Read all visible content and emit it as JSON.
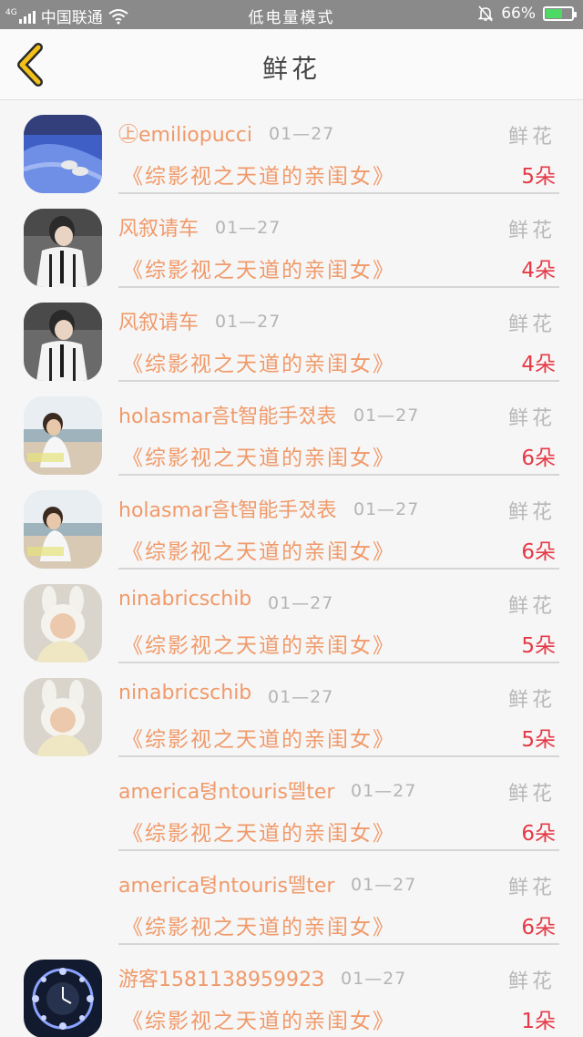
{
  "status_bar": {
    "network_label": "4G",
    "carrier": "中国联通",
    "mode": "低电量模式",
    "battery": "66%",
    "battery_level": 0.66,
    "icons": [
      "signal-icon",
      "wifi-icon",
      "mute-icon",
      "battery-icon"
    ]
  },
  "nav": {
    "title": "鲜花",
    "back_icon": "chevron-left-icon",
    "accent": "#f2c018"
  },
  "colors": {
    "name": "#f09a6a",
    "count": "#e53a47",
    "muted": "#b4b4b4"
  },
  "rows": [
    {
      "name": "㊤emiliopucci",
      "date": "01—27",
      "type": "鲜花",
      "book": "《综影视之天道的亲闺女》",
      "count": "5朵",
      "avatar": "blue-water-photo"
    },
    {
      "name": "风叙请车",
      "date": "01—27",
      "type": "鲜花",
      "book": "《综影视之天道的亲闺女》",
      "count": "4朵",
      "avatar": "boy-in-uniform-photo"
    },
    {
      "name": "风叙请车",
      "date": "01—27",
      "type": "鲜花",
      "book": "《综影视之天道的亲闺女》",
      "count": "4朵",
      "avatar": "boy-in-uniform-photo"
    },
    {
      "name": "holasmar흠t智能手졌表",
      "date": "01—27",
      "type": "鲜花",
      "book": "《综影视之天道的亲闺女》",
      "count": "6朵",
      "avatar": "boy-on-beach-photo"
    },
    {
      "name": "holasmar흠t智能手졌表",
      "date": "01—27",
      "type": "鲜花",
      "book": "《综影视之天道的亲闺女》",
      "count": "6朵",
      "avatar": "boy-on-beach-photo"
    },
    {
      "name": "ninabricschib",
      "date": "01—27",
      "type": "鲜花",
      "book": "《综影视之天道的亲闺女》",
      "count": "5朵",
      "avatar": "child-bunny-ears-photo"
    },
    {
      "name": "ninabricschib",
      "date": "01—27",
      "type": "鲜花",
      "book": "《综影视之天道的亲闺女》",
      "count": "5朵",
      "avatar": "child-bunny-ears-photo"
    },
    {
      "name": "america텽ntouris뗄ter",
      "date": "01—27",
      "type": "鲜花",
      "book": "《综影视之天道的亲闺女》",
      "count": "6朵",
      "avatar": ""
    },
    {
      "name": "america텽ntouris뗄ter",
      "date": "01—27",
      "type": "鲜花",
      "book": "《综影视之天道的亲闺女》",
      "count": "6朵",
      "avatar": ""
    },
    {
      "name": "游客158113895992З",
      "date": "01—27",
      "type": "鲜花",
      "book": "《综影视之天道的亲闺女》",
      "count": "1朵",
      "avatar": "zodiac-clock-photo"
    }
  ]
}
